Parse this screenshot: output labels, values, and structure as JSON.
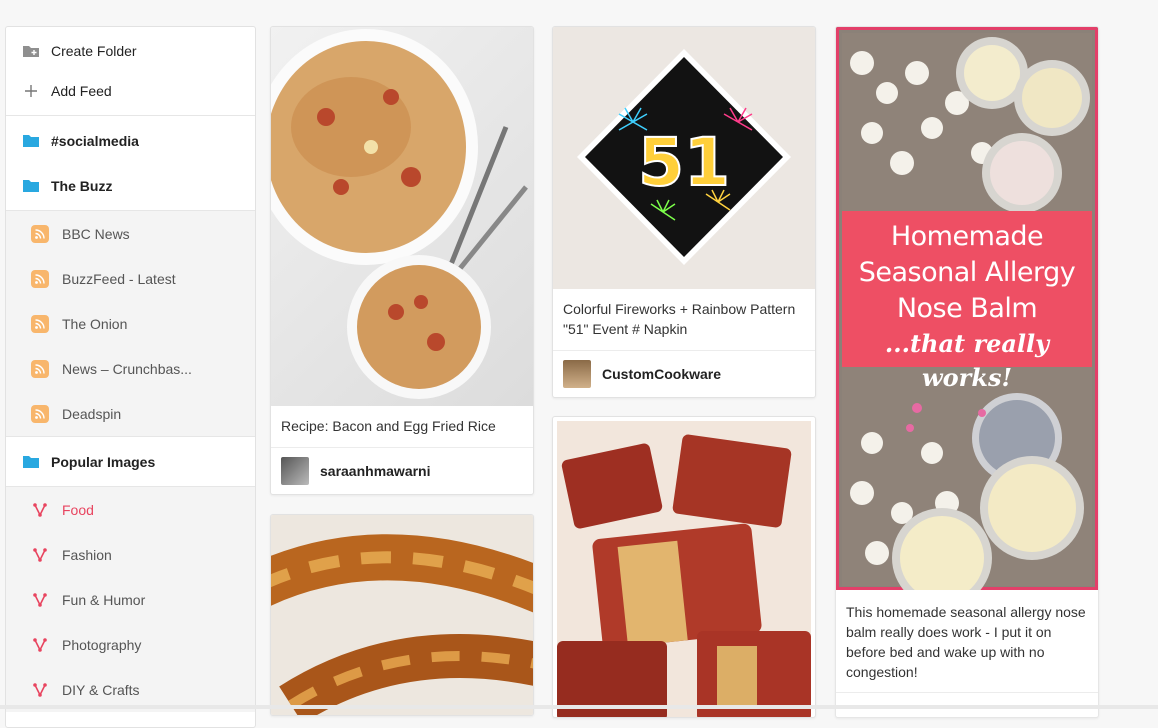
{
  "sidebar": {
    "actions": [
      {
        "label": "Create Folder",
        "icon": "folder-plus-icon"
      },
      {
        "label": "Add Feed",
        "icon": "plus-icon"
      }
    ],
    "folders_top": [
      {
        "label": "#socialmedia",
        "icon": "folder-icon"
      },
      {
        "label": "The Buzz",
        "icon": "folder-icon"
      }
    ],
    "feeds": [
      {
        "label": "BBC News",
        "icon": "rss-icon"
      },
      {
        "label": "BuzzFeed - Latest",
        "icon": "rss-icon"
      },
      {
        "label": "The Onion",
        "icon": "rss-icon"
      },
      {
        "label": "News – Crunchbas...",
        "icon": "rss-icon"
      },
      {
        "label": "Deadspin",
        "icon": "rss-icon"
      }
    ],
    "popular_folder": {
      "label": "Popular Images",
      "icon": "folder-icon"
    },
    "categories": [
      {
        "label": "Food",
        "active": true,
        "icon": "category-icon"
      },
      {
        "label": "Fashion",
        "icon": "category-icon"
      },
      {
        "label": "Fun & Humor",
        "icon": "category-icon"
      },
      {
        "label": "Photography",
        "icon": "category-icon"
      },
      {
        "label": "DIY & Crafts",
        "icon": "category-icon"
      }
    ]
  },
  "cards": {
    "rice": {
      "caption": "Recipe: Bacon and Egg Fried Rice",
      "author": "saraanhmawarni"
    },
    "napkin": {
      "caption": "Colorful Fireworks + Rainbow Pattern \"51\" Event # Napkin",
      "napkin_number": "51",
      "author": "CustomCookware"
    },
    "balm": {
      "overlay_lines": [
        "Homemade",
        "Seasonal Allergy",
        "Nose Balm"
      ],
      "overlay_script": "...that really works!",
      "caption": "This homemade seasonal allergy nose balm really does work - I put it on before bed and wake up with no congestion!"
    }
  },
  "colors": {
    "accent": "#e33f69",
    "folder": "#29a8e0",
    "rss": "#f8b66c"
  }
}
